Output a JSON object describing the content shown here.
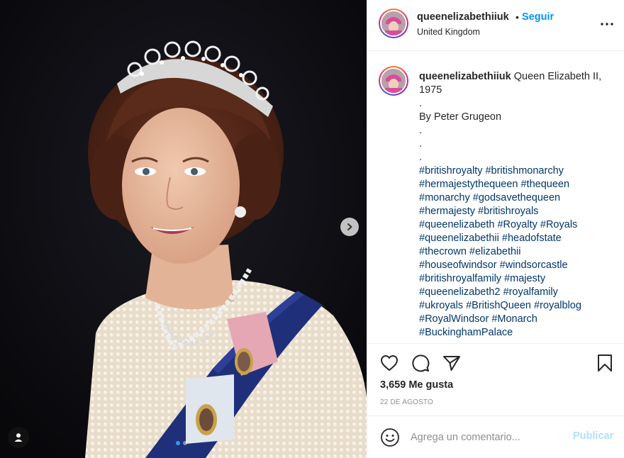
{
  "post": {
    "username": "queenelizabethiiuk",
    "separator": "•",
    "follow_label": "Seguir",
    "location": "United Kingdom",
    "more_icon": "more-horizontal-icon"
  },
  "caption": {
    "username": "queenelizabethiiuk",
    "lines": [
      "Queen Elizabeth II, 1975",
      ".",
      "By Peter Grugeon",
      ".",
      ".",
      "."
    ],
    "hashtags": [
      "#britishroyalty #britishmonarchy",
      "#hermajestythequeen #thequeen",
      "#monarchy #godsavethequeen",
      "#hermajesty #britishroyals",
      "#queenelizabeth #Royalty #Royals",
      "#queenelizabethii #headofstate",
      "#thecrown #elizabethii",
      "#houseofwindsor #windsorcastle",
      "#britishroyalfamily #majesty",
      "#queenelizabeth2 #royalfamily",
      "#ukroyals #BritishQueen #royalblog",
      "#RoyalWindsor #Monarch",
      "#BuckinghamPalace"
    ]
  },
  "actions": {
    "likes": "3,659 Me gusta",
    "date": "22 DE AGOSTO"
  },
  "comment": {
    "placeholder": "Agrega un comentario...",
    "publish_label": "Publicar"
  },
  "carousel": {
    "total": 2,
    "current": 1
  },
  "colors": {
    "link_blue": "#0095f6",
    "hashtag_blue": "#00376b",
    "publish_disabled": "#b2dffc",
    "sash_blue": "#1f2f7a"
  }
}
